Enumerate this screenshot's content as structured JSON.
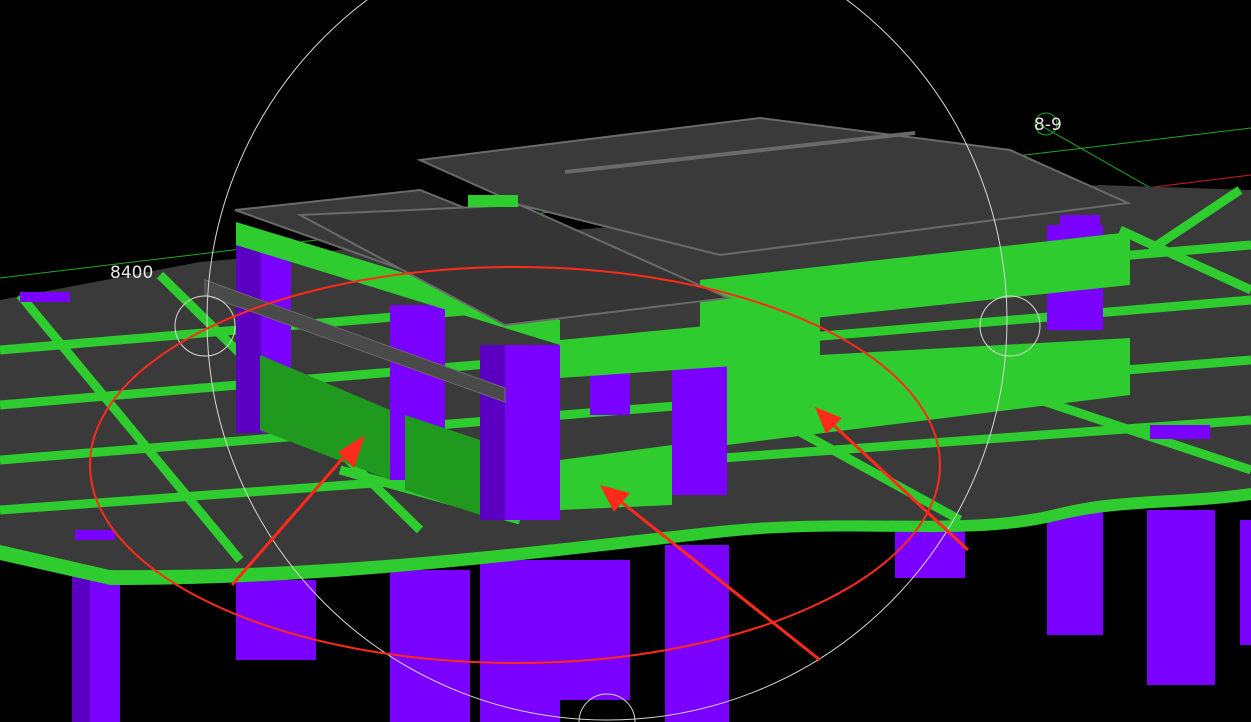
{
  "viewport": {
    "background": "#000000",
    "axis_labels": {
      "dimension": "8400",
      "grid_bubble": "8-9"
    }
  },
  "colors": {
    "beam": "#2ecc2e",
    "beam_shade": "#1f9a1f",
    "column": "#7a00ff",
    "column_shade": "#5b00c2",
    "slab": "#3a3a3a",
    "slab_edge": "#6a6a6a",
    "annotation": "#ff2a1a",
    "navigation_ring": "#d8d8d8"
  },
  "icons": {
    "orbit": "orbit-ring-icon",
    "annotation_arrow": "arrow-icon",
    "highlight": "ellipse-highlight"
  }
}
